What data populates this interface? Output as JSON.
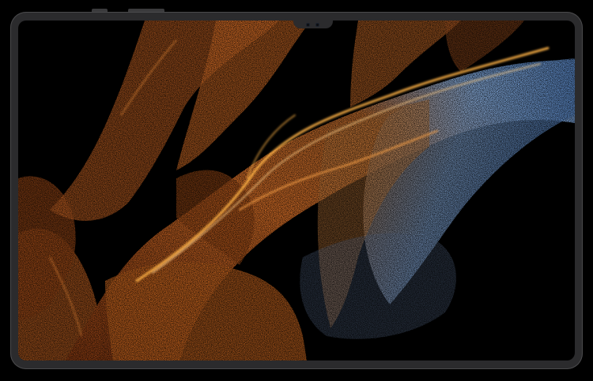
{
  "image": {
    "subject": "tablet-front-view",
    "wallpaper": "particle-waves",
    "colors": {
      "background": "#000000",
      "bezel": "#2b2b2d",
      "screen": "#000000",
      "orange_bright": "#ffb347",
      "orange_main": "#e8772a",
      "orange_dark": "#8a3a12",
      "blue_light": "#8fb6e8",
      "blue_main": "#4d7fc4"
    }
  }
}
